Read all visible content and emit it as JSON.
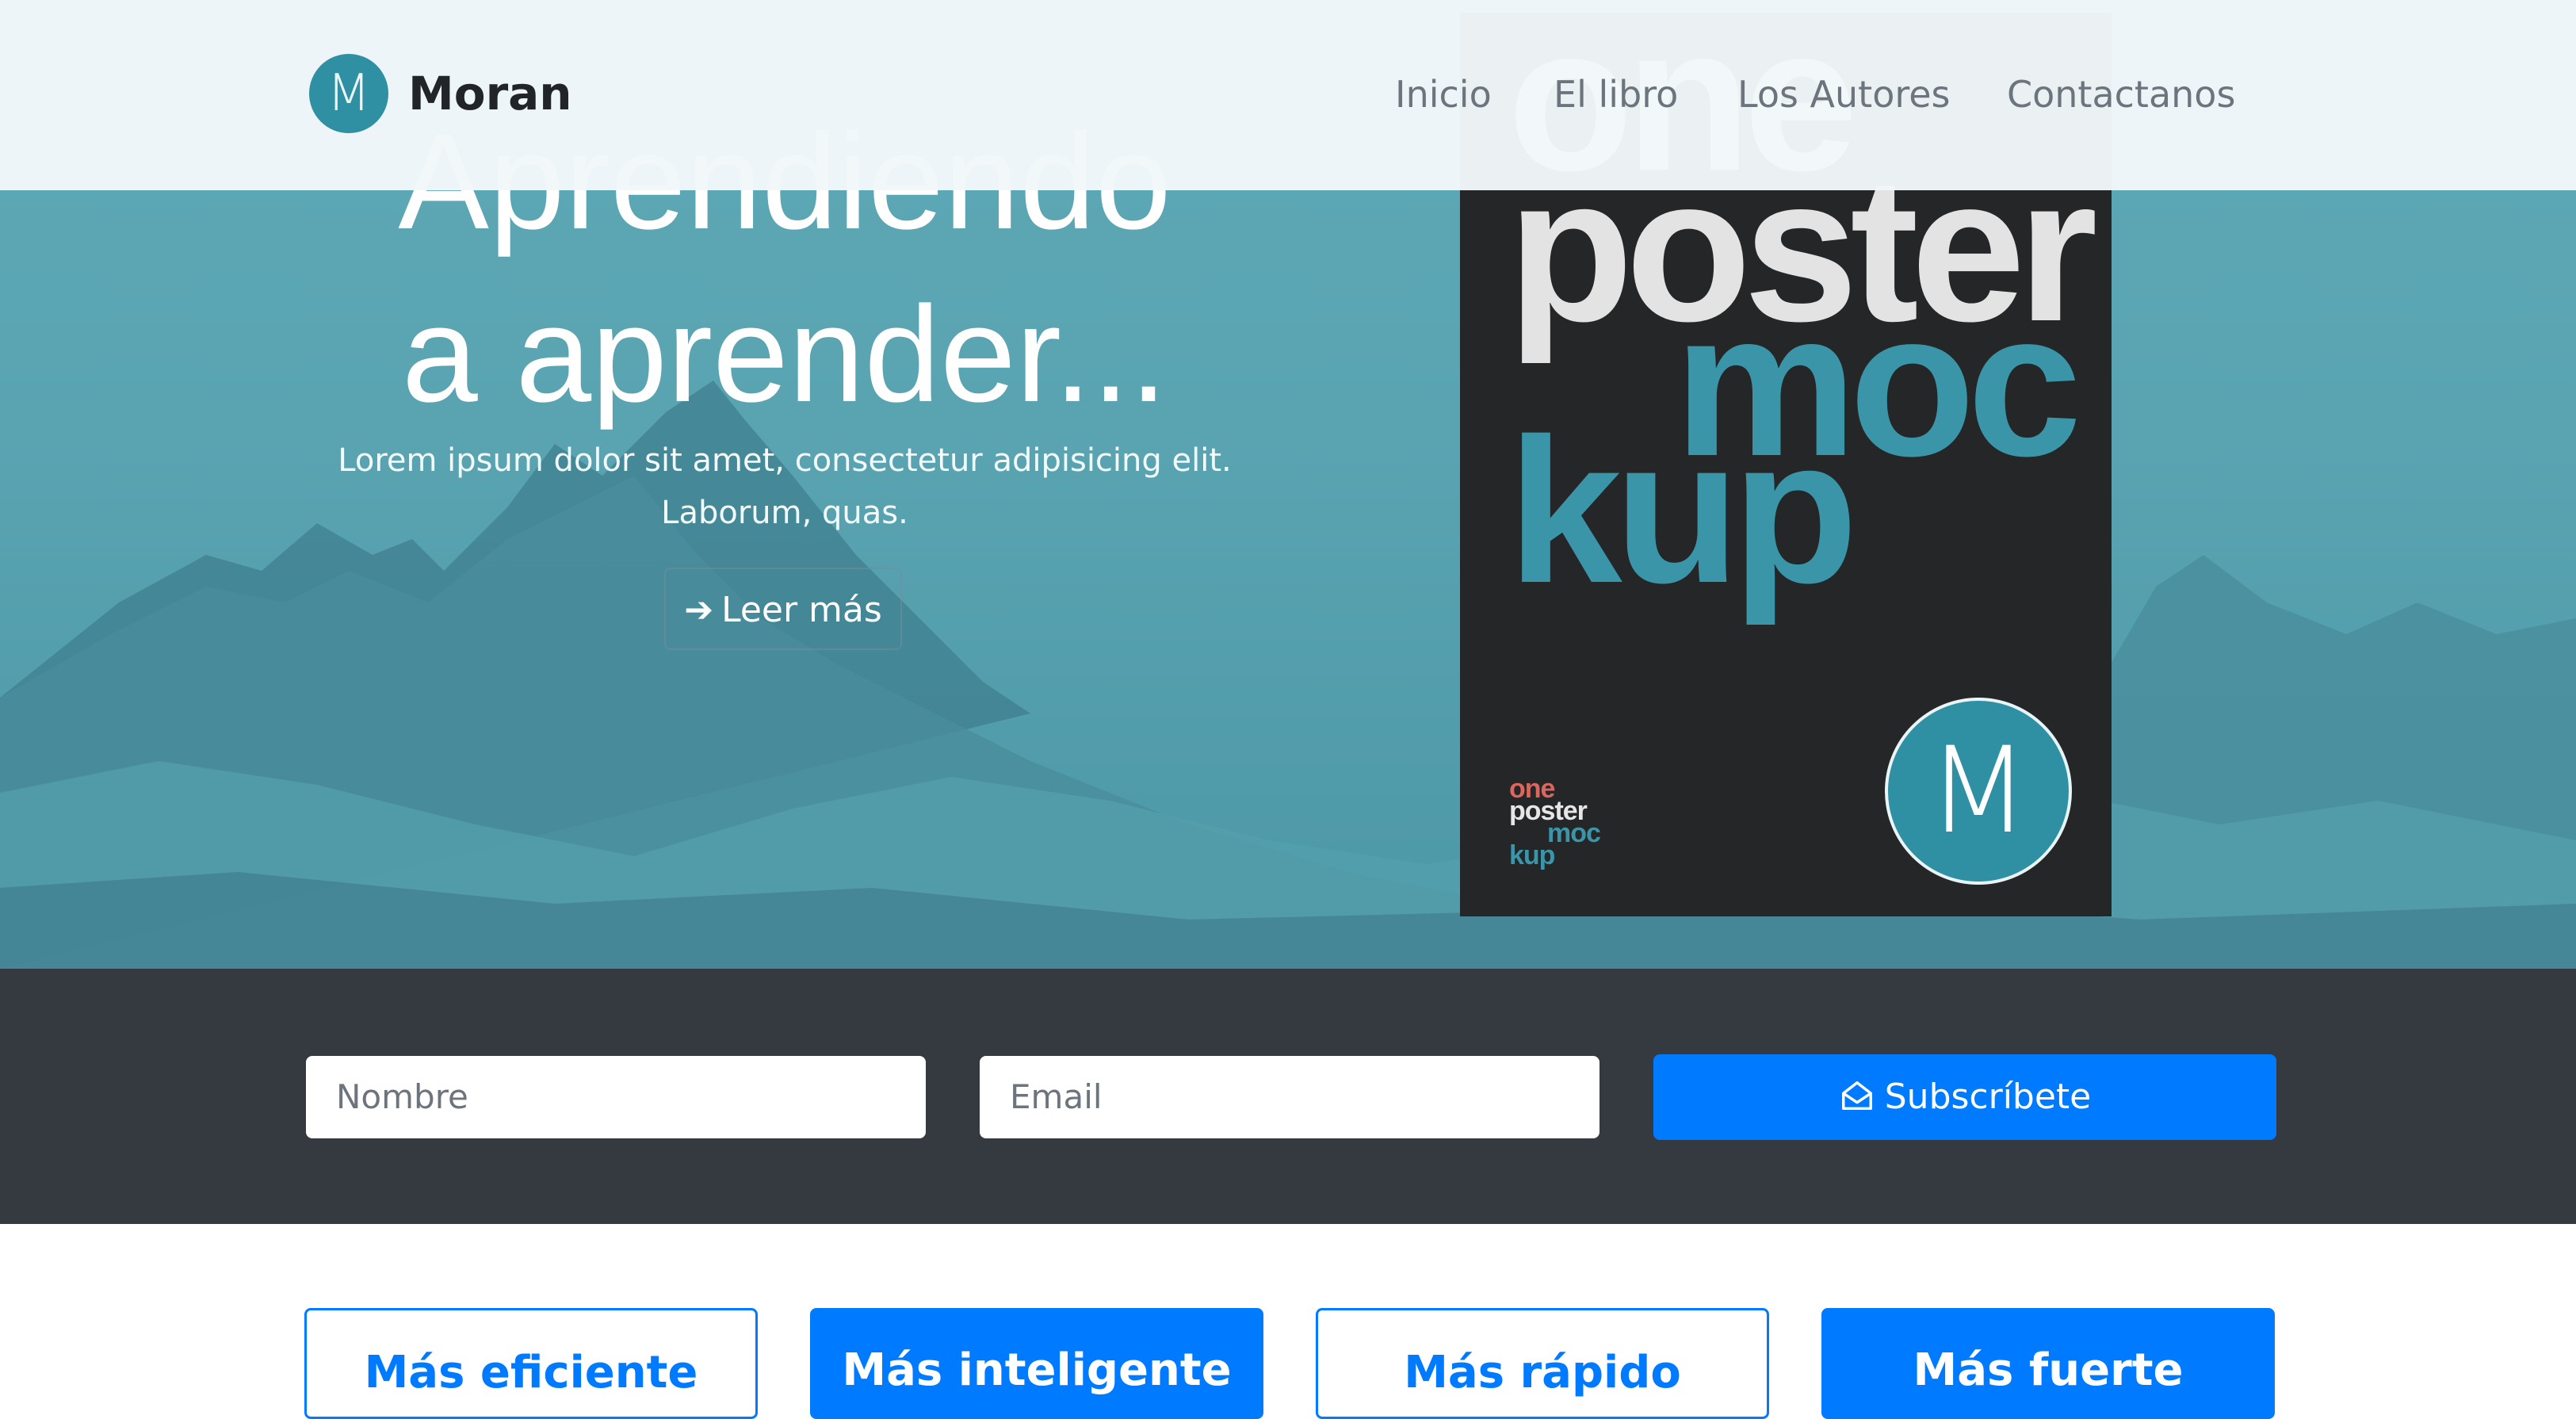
{
  "brand": {
    "logo_letter": "M",
    "name": "Moran"
  },
  "nav": [
    {
      "label": "Inicio"
    },
    {
      "label": "El libro"
    },
    {
      "label": "Los Autores"
    },
    {
      "label": "Contactanos"
    }
  ],
  "hero": {
    "title_line1": "Aprendiendo",
    "title_line2": "a aprender...",
    "subtitle_line1": "Lorem ipsum dolor sit amet, consectetur adipisicing elit.",
    "subtitle_line2": "Laborum, quas.",
    "cta_label": "Leer más",
    "cta_icon": "arrow-right-icon"
  },
  "poster": {
    "word1": "one",
    "word2": "poster",
    "word3": "moc",
    "word4": "kup",
    "logo_letter": "M"
  },
  "subscribe": {
    "name_placeholder": "Nombre",
    "email_placeholder": "Email",
    "button_label": "Subscríbete",
    "button_icon": "envelope-open-icon"
  },
  "features": [
    {
      "label": "Más eficiente"
    },
    {
      "label": "Más inteligente"
    },
    {
      "label": "Más rápido"
    },
    {
      "label": "Más fuerte"
    }
  ],
  "colors": {
    "hero_teal": "#5aa4b2",
    "logo_teal": "#2f8fa3",
    "dark_band": "#343a40",
    "primary_blue": "#007bff"
  }
}
